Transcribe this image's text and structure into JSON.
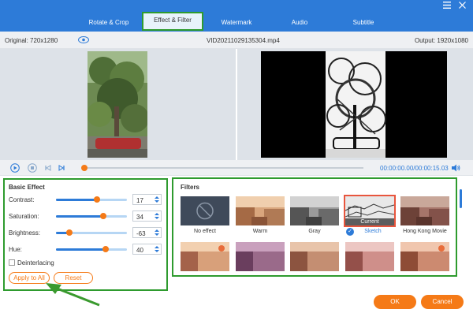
{
  "tabs": [
    {
      "label": "Rotate & Crop"
    },
    {
      "label": "Effect & Filter"
    },
    {
      "label": "Watermark"
    },
    {
      "label": "Audio"
    },
    {
      "label": "Subtitle"
    }
  ],
  "window": {
    "menu_icon": "hamburger-icon",
    "close_icon": "close-icon"
  },
  "info": {
    "original": "Original: 720x1280",
    "filename": "VID20211029135304.mp4",
    "output": "Output: 1920x1080"
  },
  "playback": {
    "time": "00:00:00.00/00:00:15.03",
    "progress": 0.0
  },
  "basic_effect": {
    "title": "Basic Effect",
    "params": [
      {
        "label": "Contrast:",
        "value": "17",
        "level": 0.58
      },
      {
        "label": "Saturation:",
        "value": "34",
        "level": 0.67
      },
      {
        "label": "Brightness:",
        "value": "-63",
        "level": 0.19
      },
      {
        "label": "Hue:",
        "value": "40",
        "level": 0.7
      }
    ],
    "deinterlacing_label": "Deinterlacing",
    "deinterlacing_checked": false,
    "apply_all_label": "Apply to All",
    "reset_label": "Reset"
  },
  "filters": {
    "title": "Filters",
    "items": [
      {
        "label": "No effect"
      },
      {
        "label": "Warm"
      },
      {
        "label": "Gray"
      },
      {
        "label": "Sketch",
        "selected": true,
        "tag": "Current"
      },
      {
        "label": "Hong Kong Movie"
      },
      {
        "label": ""
      },
      {
        "label": ""
      },
      {
        "label": ""
      },
      {
        "label": ""
      },
      {
        "label": ""
      }
    ]
  },
  "footer": {
    "ok_label": "OK",
    "cancel_label": "Cancel"
  },
  "colors": {
    "accent": "#2d7bd8",
    "orange": "#f57a17",
    "highlight_green": "#2e9b2e"
  }
}
